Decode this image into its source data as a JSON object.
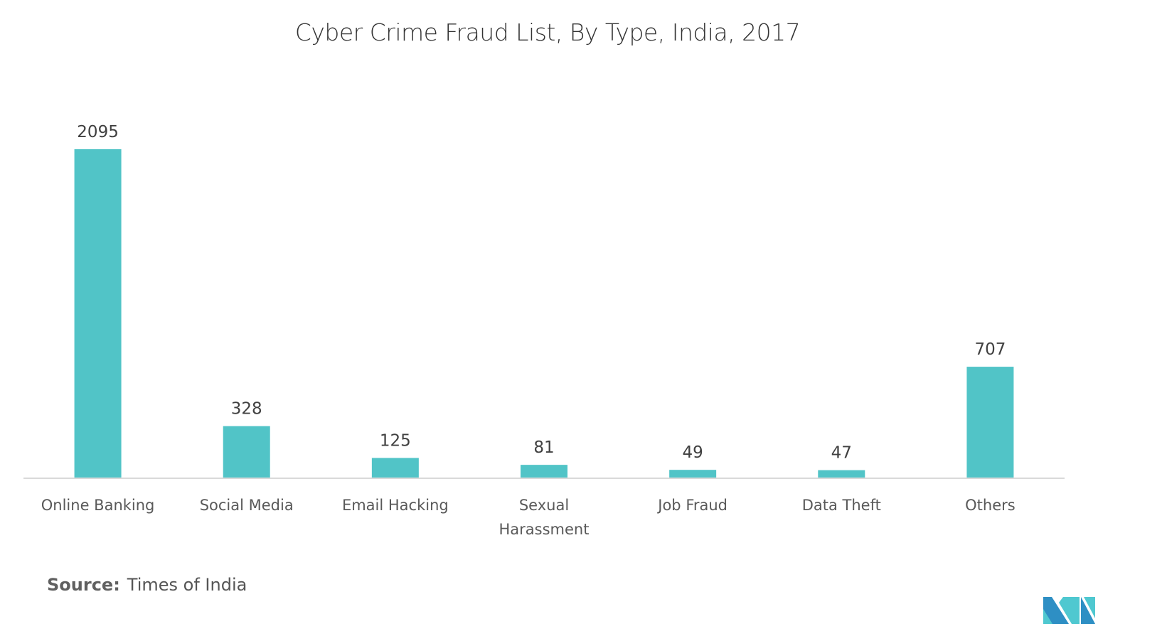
{
  "title": "Cyber Crime Fraud List, By Type, India, 2017",
  "source": {
    "label": "Source:",
    "text": "Times of India"
  },
  "logo": {
    "name": "mordor-intelligence-logo",
    "colors": [
      "#2e8fc4",
      "#4fc8d0"
    ]
  },
  "colors": {
    "bar": "#51c4c7",
    "axis": "#d9d9d9"
  },
  "chart_data": {
    "type": "bar",
    "title": "Cyber Crime Fraud List, By Type, India, 2017",
    "xlabel": "",
    "ylabel": "",
    "categories": [
      "Online Banking",
      "Social Media",
      "Email Hacking",
      "Sexual Harassment",
      "Job Fraud",
      "Data Theft",
      "Others"
    ],
    "category_lines": [
      [
        "Online Banking"
      ],
      [
        "Social Media"
      ],
      [
        "Email Hacking"
      ],
      [
        "Sexual",
        "Harassment"
      ],
      [
        "Job Fraud"
      ],
      [
        "Data Theft"
      ],
      [
        "Others"
      ]
    ],
    "values": [
      2095,
      328,
      125,
      81,
      49,
      47,
      707
    ],
    "ylim": [
      0,
      2095
    ],
    "grid": false,
    "legend": "none",
    "data_labels": true
  }
}
